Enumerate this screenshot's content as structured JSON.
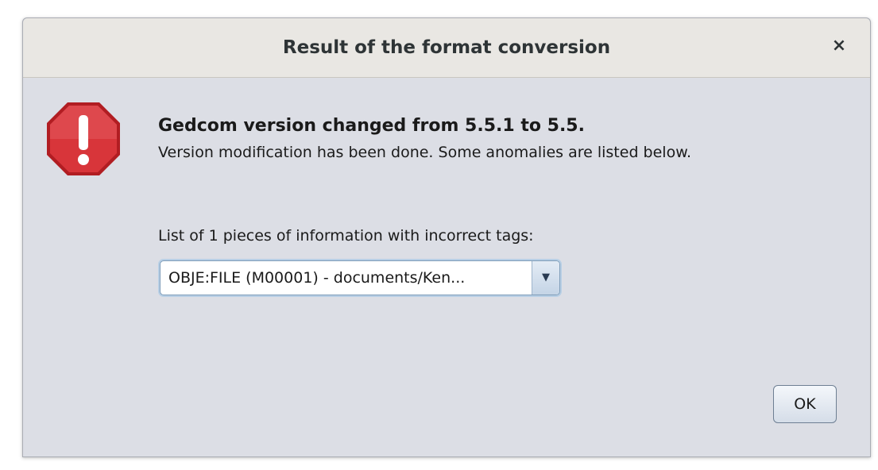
{
  "dialog": {
    "title": "Result of the format conversion",
    "close_glyph": "×",
    "icon": "error-octagon-icon",
    "heading": "Gedcom version changed from 5.5.1 to 5.5.",
    "message": "Version modification has been done. Some anomalies are listed below.",
    "list_label": "List of 1 pieces of information with incorrect tags:",
    "combo": {
      "selected": "OBJE:FILE (M00001) - documents/Ken...",
      "arrow_glyph": "▼"
    },
    "ok_label": "OK"
  },
  "colors": {
    "icon_red": "#c8262b",
    "dialog_bg": "#dcdee5",
    "titlebar_bg": "#e9e7e3"
  }
}
